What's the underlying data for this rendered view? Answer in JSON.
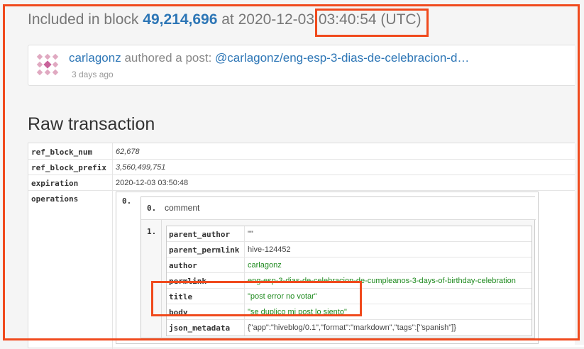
{
  "header": {
    "prefix": "Included in block",
    "block_number": "49,214,696",
    "at": "at",
    "timestamp": "2020-12-03 03:40:54 (UTC)"
  },
  "post": {
    "author": "carlagonz",
    "action": " authored a post: ",
    "link": "@carlagonz/eng-esp-3-dias-de-celebracion-d…",
    "time": "3 days ago"
  },
  "raw_transaction": {
    "title": "Raw transaction",
    "rows": [
      {
        "key": "ref_block_num",
        "value": "62,678"
      },
      {
        "key": "ref_block_prefix",
        "value": "3,560,499,751"
      },
      {
        "key": "expiration",
        "value": "2020-12-03 03:50:48"
      },
      {
        "key": "operations",
        "value": ""
      }
    ],
    "operations": {
      "index": "0.",
      "op0_index": "0.",
      "op0_type": "comment",
      "op1_index": "1.",
      "fields": [
        {
          "key": "parent_author",
          "value": "\"\""
        },
        {
          "key": "parent_permlink",
          "value": "hive-124452"
        },
        {
          "key": "author",
          "value": "carlagonz"
        },
        {
          "key": "permlink",
          "value": "eng-esp-3-dias-de-celebracion-de-cumpleanos-3-days-of-birthday-celebration"
        },
        {
          "key": "title",
          "value": "\"post error no votar\""
        },
        {
          "key": "body",
          "value": "\"se duplico mi post lo siento\""
        },
        {
          "key": "json_metadata",
          "value": "{\"app\":\"hiveblog/0.1\",\"format\":\"markdown\",\"tags\":[\"spanish\"]}"
        }
      ]
    }
  },
  "colors": {
    "link": "#2d76b6",
    "highlight": "#f04a1d",
    "string_value": "#1e8a1e"
  }
}
